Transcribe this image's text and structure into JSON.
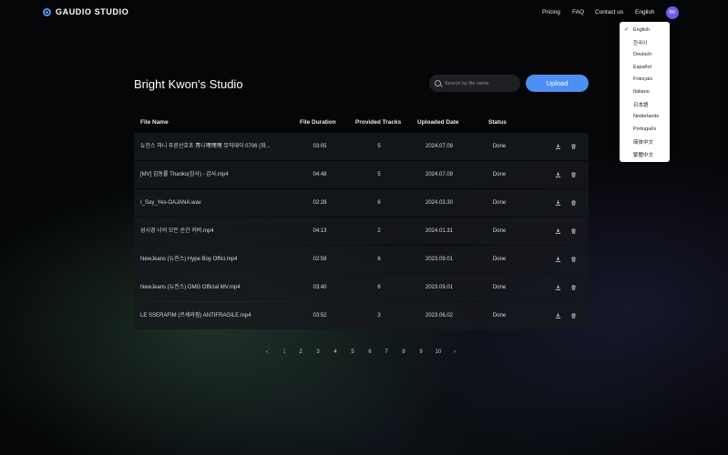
{
  "app": {
    "logo_text": "GAUDIO STUDIO"
  },
  "nav": {
    "links": [
      "Pricing",
      "FAQ",
      "Contact us",
      "English"
    ],
    "avatar_initials": "BK"
  },
  "language_menu": {
    "selected": "English",
    "options": [
      "English",
      "한국어",
      "Deutsch",
      "Español",
      "Français",
      "Italiano",
      "日本語",
      "Nederlands",
      "Português",
      "简体中文",
      "繁體中文"
    ]
  },
  "page": {
    "title": "Bright Kwon's Studio"
  },
  "search": {
    "placeholder": "Search by file name",
    "value": ""
  },
  "upload_label": "Upload",
  "table": {
    "columns": [
      "File Name",
      "File Duration",
      "Provided Tracks",
      "Uploaded Date",
      "Status"
    ],
    "rows": [
      {
        "name": "뉴진스 하니 푸른산호초 靑니嘿嘿嘿 뮤직데이 0706 (화...",
        "duration": "03:05",
        "tracks": "5",
        "date": "2024.07.09",
        "status": "Done"
      },
      {
        "name": "[MV] 김동률 Thanks(감사) - 감사.mp4",
        "duration": "04:48",
        "tracks": "5",
        "date": "2024.07.09",
        "status": "Done"
      },
      {
        "name": "I_Say_Yes-OAJANA.wav",
        "duration": "02:28",
        "tracks": "6",
        "date": "2024.03.30",
        "status": "Done"
      },
      {
        "name": "성시경 너의 모든 순간 커버.mp4",
        "duration": "04:13",
        "tracks": "2",
        "date": "2024.01.31",
        "status": "Done"
      },
      {
        "name": "NewJeans (뉴진스) Hype Boy Offici.mp4",
        "duration": "02:58",
        "tracks": "6",
        "date": "2023.09.01",
        "status": "Done"
      },
      {
        "name": "NewJeans (뉴진스) OMG Official MV.mp4",
        "duration": "03:40",
        "tracks": "6",
        "date": "2023.09.01",
        "status": "Done"
      },
      {
        "name": "LE SSERAFIM (르세라핌) ANTIFRAGILE.mp4",
        "duration": "03:52",
        "tracks": "3",
        "date": "2023.06.02",
        "status": "Done"
      }
    ]
  },
  "pagination": {
    "prev_icon": "‹",
    "next_icon": "›",
    "pages": [
      "1",
      "2",
      "3",
      "4",
      "5",
      "6",
      "7",
      "8",
      "9",
      "10"
    ],
    "current": "1"
  },
  "colors": {
    "accent": "#4d8ff2",
    "avatar": "#6a5cf0",
    "background": "#050607"
  },
  "icons": {
    "download": "download-icon",
    "delete": "trash-icon"
  }
}
